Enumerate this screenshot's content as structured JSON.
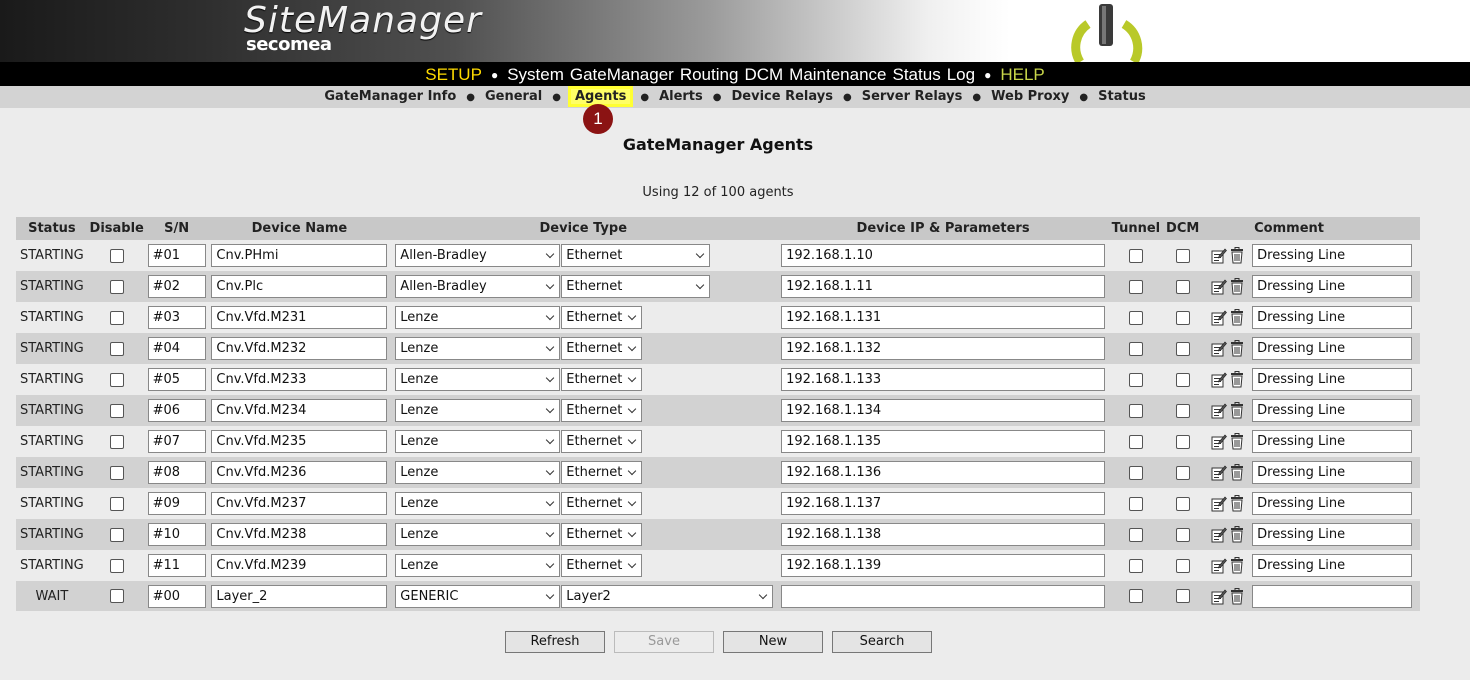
{
  "brand": {
    "name": "SiteManager",
    "sub": "secomea"
  },
  "topnav": [
    {
      "label": "SETUP",
      "style": "y"
    },
    {
      "label": "System",
      "style": ""
    },
    {
      "label": "GateManager",
      "style": ""
    },
    {
      "label": "Routing",
      "style": ""
    },
    {
      "label": "DCM",
      "style": ""
    },
    {
      "label": "Maintenance",
      "style": ""
    },
    {
      "label": "Status",
      "style": ""
    },
    {
      "label": "Log",
      "style": ""
    },
    {
      "label": "HELP",
      "style": "g"
    }
  ],
  "subnav": [
    "GateManager Info",
    "General",
    "Agents",
    "Alerts",
    "Device Relays",
    "Server Relays",
    "Web Proxy",
    "Status"
  ],
  "badge": "1",
  "page_title": "GateManager Agents",
  "usage": "Using 12 of 100 agents",
  "columns": {
    "status": "Status",
    "disable": "Disable",
    "sn": "S/N",
    "name": "Device Name",
    "type": "Device Type",
    "ip": "Device IP & Parameters",
    "tunnel": "Tunnel",
    "dcm": "DCM",
    "comment": "Comment"
  },
  "rows": [
    {
      "status": "STARTING",
      "sn": "#01",
      "name": "Cnv.PHmi",
      "type": "Allen-Bradley",
      "subtype": "Ethernet",
      "ip": "192.168.1.10",
      "comment": "Dressing Line"
    },
    {
      "status": "STARTING",
      "sn": "#02",
      "name": "Cnv.Plc",
      "type": "Allen-Bradley",
      "subtype": "Ethernet",
      "ip": "192.168.1.11",
      "comment": "Dressing Line"
    },
    {
      "status": "STARTING",
      "sn": "#03",
      "name": "Cnv.Vfd.M231",
      "type": "Lenze",
      "subtype": "Ethernet",
      "ip": "192.168.1.131",
      "comment": "Dressing Line"
    },
    {
      "status": "STARTING",
      "sn": "#04",
      "name": "Cnv.Vfd.M232",
      "type": "Lenze",
      "subtype": "Ethernet",
      "ip": "192.168.1.132",
      "comment": "Dressing Line"
    },
    {
      "status": "STARTING",
      "sn": "#05",
      "name": "Cnv.Vfd.M233",
      "type": "Lenze",
      "subtype": "Ethernet",
      "ip": "192.168.1.133",
      "comment": "Dressing Line"
    },
    {
      "status": "STARTING",
      "sn": "#06",
      "name": "Cnv.Vfd.M234",
      "type": "Lenze",
      "subtype": "Ethernet",
      "ip": "192.168.1.134",
      "comment": "Dressing Line"
    },
    {
      "status": "STARTING",
      "sn": "#07",
      "name": "Cnv.Vfd.M235",
      "type": "Lenze",
      "subtype": "Ethernet",
      "ip": "192.168.1.135",
      "comment": "Dressing Line"
    },
    {
      "status": "STARTING",
      "sn": "#08",
      "name": "Cnv.Vfd.M236",
      "type": "Lenze",
      "subtype": "Ethernet",
      "ip": "192.168.1.136",
      "comment": "Dressing Line"
    },
    {
      "status": "STARTING",
      "sn": "#09",
      "name": "Cnv.Vfd.M237",
      "type": "Lenze",
      "subtype": "Ethernet",
      "ip": "192.168.1.137",
      "comment": "Dressing Line"
    },
    {
      "status": "STARTING",
      "sn": "#10",
      "name": "Cnv.Vfd.M238",
      "type": "Lenze",
      "subtype": "Ethernet",
      "ip": "192.168.1.138",
      "comment": "Dressing Line"
    },
    {
      "status": "STARTING",
      "sn": "#11",
      "name": "Cnv.Vfd.M239",
      "type": "Lenze",
      "subtype": "Ethernet",
      "ip": "192.168.1.139",
      "comment": "Dressing Line"
    },
    {
      "status": "WAIT",
      "sn": "#00",
      "name": "Layer_2",
      "type": "GENERIC",
      "subtype": "Layer2",
      "ip": "",
      "comment": ""
    }
  ],
  "buttons": {
    "refresh": "Refresh",
    "save": "Save",
    "new": "New",
    "search": "Search"
  },
  "colors": {
    "highlight": "#ffff33",
    "badge": "#8b1313",
    "nav_yellow": "#ffdb00",
    "nav_green": "#c8d64a"
  }
}
